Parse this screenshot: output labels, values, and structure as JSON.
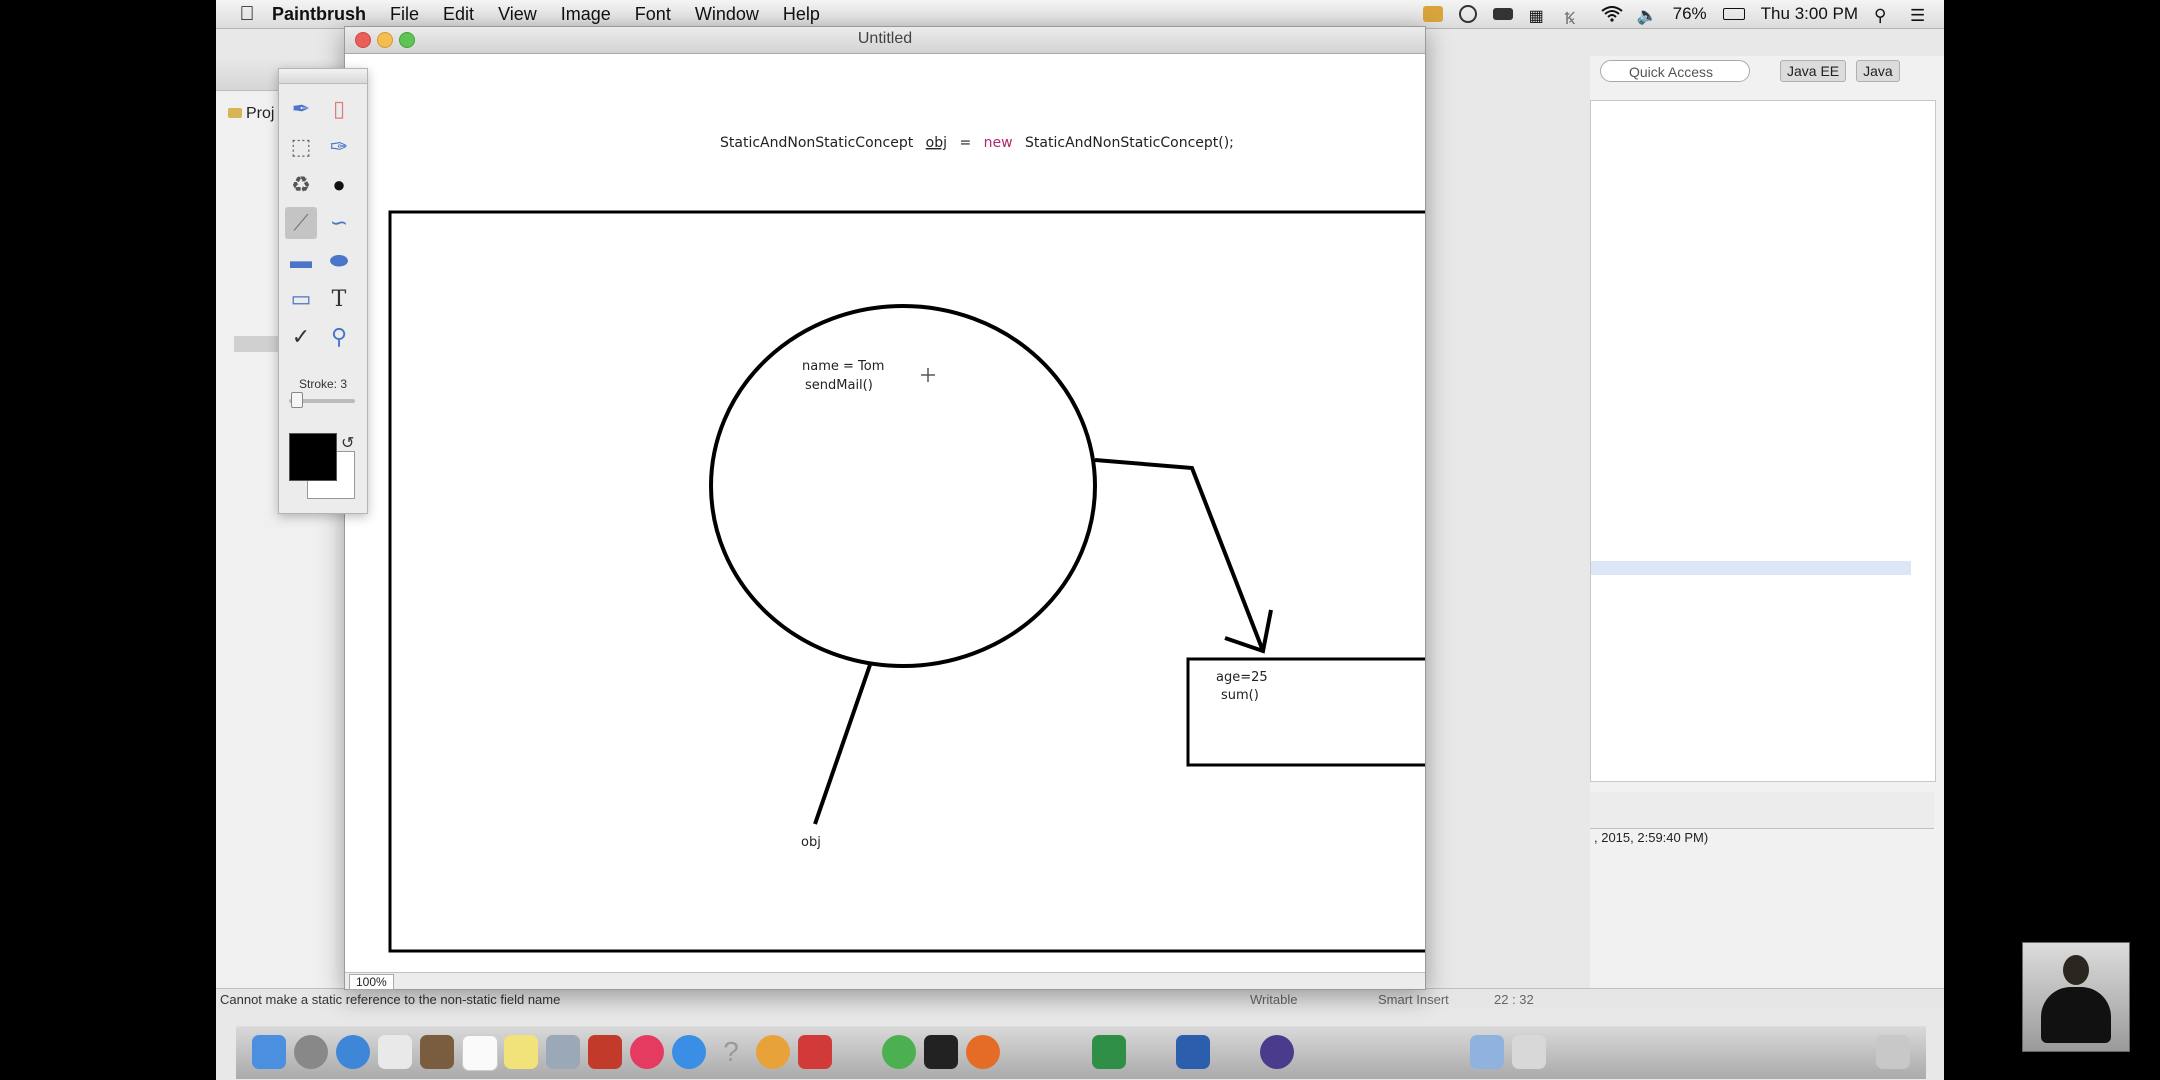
{
  "menubar": {
    "app_name": "Paintbrush",
    "items": [
      "File",
      "Edit",
      "View",
      "Image",
      "Font",
      "Window",
      "Help"
    ],
    "battery": "76%",
    "clock": "Thu 3:00 PM",
    "icons": [
      "app-status-icon",
      "time-machine-icon",
      "display-icon",
      "binoculars-icon",
      "bluetooth-icon",
      "wifi-icon",
      "volume-icon",
      "battery-icon",
      "spotlight-icon",
      "list-icon"
    ]
  },
  "eclipse": {
    "left_tab": "Proj",
    "quick_access_placeholder": "Quick Access",
    "perspectives": [
      "Java EE",
      "Java"
    ],
    "console_text": ", 2015, 2:59:40 PM)",
    "status_error": "Cannot make a static reference to the non-static field name",
    "status_writable": "Writable",
    "status_insert": "Smart Insert",
    "status_position": "22 : 32"
  },
  "paintbrush": {
    "window_title": "Untitled",
    "stroke_label": "Stroke: 3",
    "zoom": "100%",
    "colors": {
      "foreground": "#000000",
      "background": "#ffffff"
    },
    "tools": [
      "paintbrush-icon",
      "eraser-icon",
      "selection-icon",
      "lasso-icon",
      "fill-bucket-icon",
      "bomb-icon",
      "line-icon",
      "curve-icon",
      "rectangle-icon",
      "ellipse-icon",
      "rounded-rect-icon",
      "text-icon",
      "eyedropper-icon",
      "magnifier-icon"
    ],
    "selected_tool": "line-icon"
  },
  "drawing": {
    "code_parts": {
      "class_type": "StaticAndNonStaticConcept",
      "var_name": "obj",
      "equals": "=",
      "keyword": "new",
      "ctor_call": "StaticAndNonStaticConcept();"
    },
    "circle_line1": "name = Tom",
    "circle_line2": "sendMail()",
    "box_line1": "age=25",
    "box_line2": "sum()",
    "reference_label": "obj"
  }
}
